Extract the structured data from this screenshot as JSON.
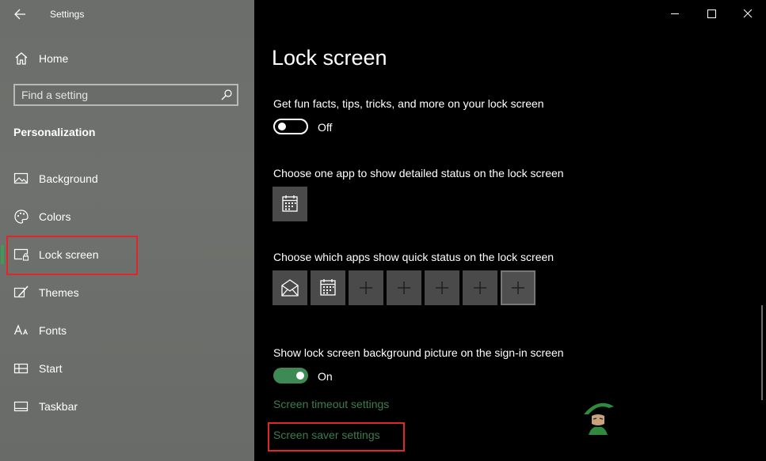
{
  "window": {
    "title": "Settings"
  },
  "sidebar": {
    "home_label": "Home",
    "search_placeholder": "Find a setting",
    "section_title": "Personalization",
    "items": [
      {
        "label": "Background",
        "icon": "picture-icon"
      },
      {
        "label": "Colors",
        "icon": "palette-icon"
      },
      {
        "label": "Lock screen",
        "icon": "lock-screen-icon",
        "selected": true
      },
      {
        "label": "Themes",
        "icon": "brush-icon"
      },
      {
        "label": "Fonts",
        "icon": "font-icon"
      },
      {
        "label": "Start",
        "icon": "start-grid-icon"
      },
      {
        "label": "Taskbar",
        "icon": "taskbar-icon"
      }
    ]
  },
  "main": {
    "title": "Lock screen",
    "fun_facts": {
      "label": "Get fun facts, tips, tricks, and more on your lock screen",
      "state": "Off"
    },
    "detailed_status": {
      "label": "Choose one app to show detailed status on the lock screen",
      "app": "calendar-icon"
    },
    "quick_status": {
      "label": "Choose which apps show quick status on the lock screen",
      "apps": [
        "mail-icon",
        "calendar-icon",
        "plus-icon",
        "plus-icon",
        "plus-icon",
        "plus-icon",
        "plus-icon"
      ]
    },
    "signin_picture": {
      "label": "Show lock screen background picture on the sign-in screen",
      "state": "On"
    },
    "links": {
      "timeout": "Screen timeout settings",
      "saver": "Screen saver settings"
    }
  },
  "colors": {
    "accent": "#3e8a55",
    "link": "#3c7d4e",
    "highlight": "#e0262b"
  }
}
